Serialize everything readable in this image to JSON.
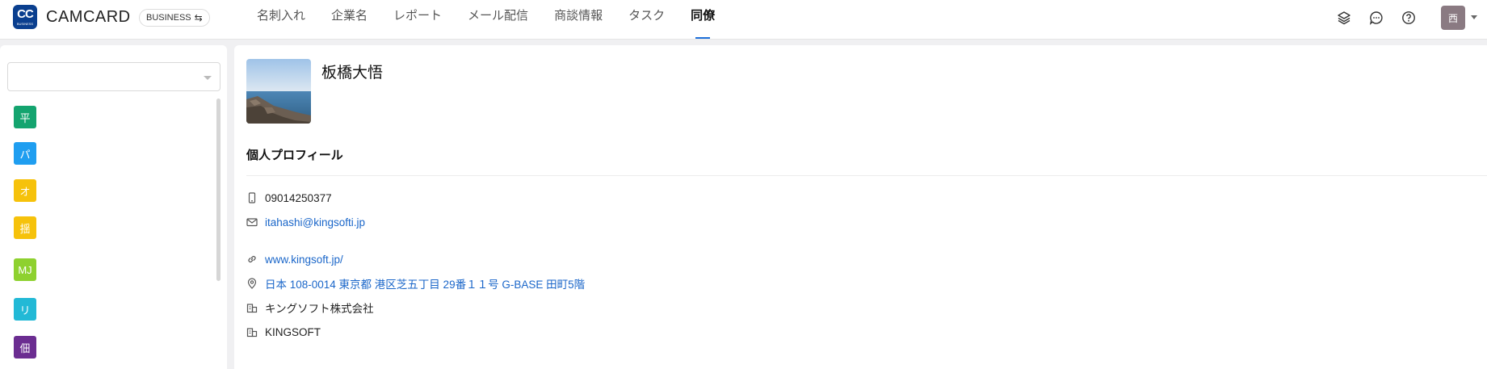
{
  "header": {
    "logo_text": "CC",
    "logo_subtext": "BUSINESS",
    "app_name": "CAMCARD",
    "edition_label": "BUSINESS",
    "edition_switch_icon": "switch-arrows-icon",
    "nav_tabs": [
      {
        "label": "名刺入れ"
      },
      {
        "label": "企業名"
      },
      {
        "label": "レポート"
      },
      {
        "label": "メール配信"
      },
      {
        "label": "商談情報"
      },
      {
        "label": "タスク"
      },
      {
        "label": "同僚",
        "active": true
      }
    ],
    "icons": [
      "layers-icon",
      "chat-icon",
      "help-icon"
    ],
    "user_avatar_char": "西",
    "accent_color": "#1e6fd9"
  },
  "sidebar": {
    "department_select": {
      "value": ""
    },
    "members": [
      {
        "initial": "平",
        "color": "#14a46f"
      },
      {
        "initial": "パ",
        "color": "#1f9ef0"
      },
      {
        "initial": "オ",
        "color": "#f6c20b"
      },
      {
        "initial": "揺",
        "color": "#f6c20b"
      },
      {
        "initial": "MJ",
        "color": "#8ed12f"
      },
      {
        "initial": "リ",
        "color": "#22b9d6"
      },
      {
        "initial": "佃",
        "color": "#6b2d91"
      }
    ]
  },
  "profile": {
    "name": "板橋大悟",
    "section_title": "個人プロフィール",
    "phone": "09014250377",
    "email": "itahashi@kingsofti.jp",
    "website": "www.kingsoft.jp/",
    "address": "日本 108-0014 東京都 港区芝五丁目 29番１１号 G-BASE 田町5階",
    "company": "キングソフト株式会社",
    "company_en": "KINGSOFT",
    "link_color": "#1a66c9"
  }
}
